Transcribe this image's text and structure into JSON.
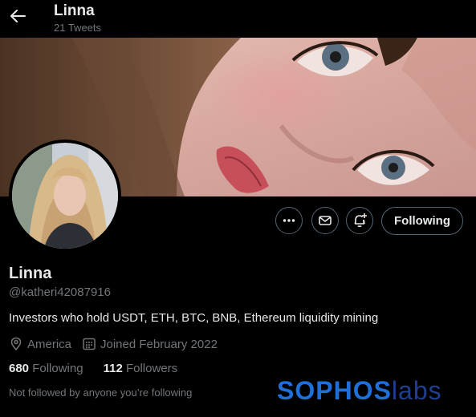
{
  "header": {
    "name": "Linna",
    "tweet_count": "21 Tweets"
  },
  "profile": {
    "display_name": "Linna",
    "handle": "@katheri42087916",
    "bio": "Investors who hold USDT, ETH, BTC, BNB, Ethereum liquidity mining",
    "location": "America",
    "joined": "Joined February 2022",
    "following_count": "680",
    "following_label": "Following",
    "followers_count": "112",
    "followers_label": "Followers",
    "followed_by": "Not followed by anyone you’re following"
  },
  "actions": {
    "more_icon": "more-icon",
    "message_icon": "envelope-icon",
    "notify_icon": "bell-plus-icon",
    "follow_label": "Following"
  },
  "watermark": {
    "part1": "SOPHOS",
    "part2": "labs"
  },
  "colors": {
    "background": "#000000",
    "text_primary": "#e7e9ea",
    "text_secondary": "#71767b",
    "border": "#536471",
    "watermark_blue": "#1f6fd8"
  }
}
